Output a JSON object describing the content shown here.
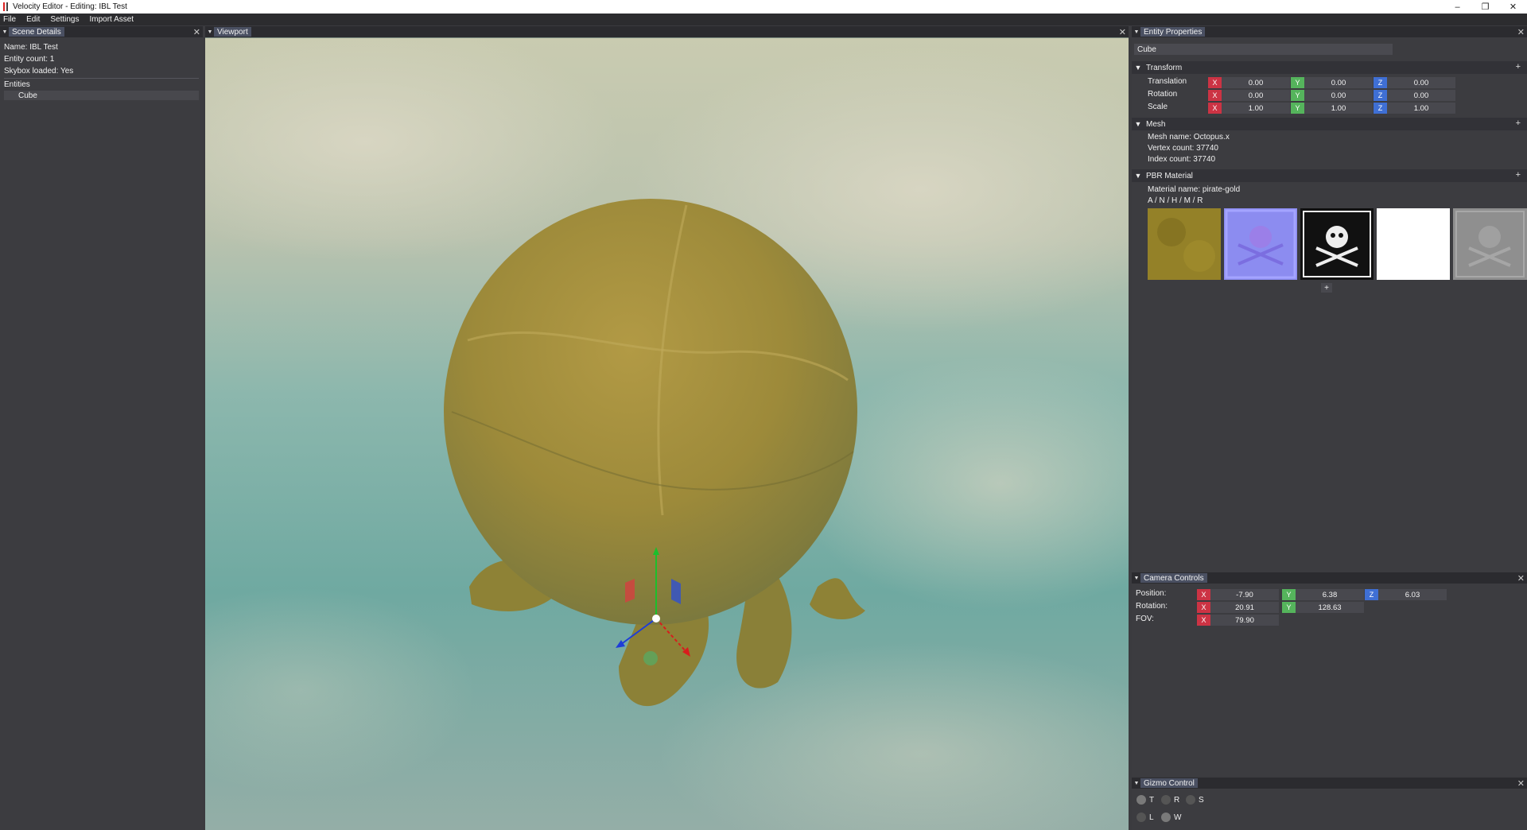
{
  "window": {
    "title": "Velocity Editor - Editing: IBL Test",
    "minimize": "–",
    "restore": "❐",
    "close": "✕"
  },
  "menu": [
    "File",
    "Edit",
    "Settings",
    "Import Asset"
  ],
  "scene_details": {
    "title": "Scene Details",
    "name": "Name: IBL Test",
    "entity_count": "Entity count: 1",
    "skybox": "Skybox loaded: Yes",
    "entities_label": "Entities",
    "entities": [
      "Cube"
    ]
  },
  "viewport": {
    "title": "Viewport"
  },
  "entity_properties": {
    "title": "Entity Properties",
    "entity_name": "Cube",
    "transform": {
      "title": "Transform",
      "rows": [
        {
          "label": "Translation",
          "x": "0.00",
          "y": "0.00",
          "z": "0.00"
        },
        {
          "label": "Rotation",
          "x": "0.00",
          "y": "0.00",
          "z": "0.00"
        },
        {
          "label": "Scale",
          "x": "1.00",
          "y": "1.00",
          "z": "1.00"
        }
      ]
    },
    "mesh": {
      "title": "Mesh",
      "name": "Mesh name: Octopus.x",
      "vertex_count": "Vertex count: 37740",
      "index_count": "Index count: 37740"
    },
    "material": {
      "title": "PBR Material",
      "name": "Material name: pirate-gold",
      "channels": "A / N / H / M / R",
      "add": "+"
    }
  },
  "camera_controls": {
    "title": "Camera Controls",
    "position_label": "Position:",
    "rotation_label": "Rotation:",
    "fov_label": "FOV:",
    "position": {
      "x": "-7.90",
      "y": "6.38",
      "z": "6.03"
    },
    "rotation": {
      "x": "20.91",
      "y": "128.63"
    },
    "fov": {
      "x": "79.90"
    }
  },
  "gizmo_control": {
    "title": "Gizmo Control",
    "modes": [
      "T",
      "R",
      "S"
    ],
    "spaces": [
      "L",
      "W"
    ]
  },
  "axis": {
    "x": "X",
    "y": "Y",
    "z": "Z"
  },
  "plus": "+",
  "close": "✕"
}
